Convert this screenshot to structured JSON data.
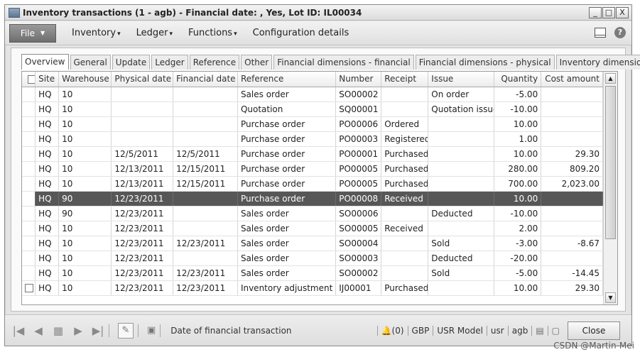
{
  "window": {
    "title": "Inventory transactions (1 - agb) - Financial date: , Yes, Lot ID: IL00034",
    "min_glyph": "_",
    "max_glyph": "□",
    "close_glyph": "X"
  },
  "menubar": {
    "file_label": "File",
    "items": [
      {
        "label": "Inventory",
        "caret": "▾"
      },
      {
        "label": "Ledger",
        "caret": "▾"
      },
      {
        "label": "Functions",
        "caret": "▾"
      },
      {
        "label": "Configuration details",
        "caret": ""
      }
    ],
    "help_glyph": "?"
  },
  "tabs": [
    "Overview",
    "General",
    "Update",
    "Ledger",
    "Reference",
    "Other",
    "Financial dimensions - financial",
    "Financial dimensions - physical",
    "Inventory dimensions"
  ],
  "grid": {
    "columns": [
      "",
      "Site",
      "Warehouse",
      "Physical date",
      "Financial date",
      "Reference",
      "Number",
      "Receipt",
      "Issue",
      "Quantity",
      "Cost amount"
    ],
    "selected_row_index": 7,
    "rows": [
      {
        "site": "HQ",
        "warehouse": "10",
        "physical_date": "",
        "financial_date": "",
        "reference": "Sales order",
        "number": "SO00002",
        "receipt": "",
        "issue": "On order",
        "quantity": "-5.00",
        "cost_amount": ""
      },
      {
        "site": "HQ",
        "warehouse": "10",
        "physical_date": "",
        "financial_date": "",
        "reference": "Quotation",
        "number": "SQ00001",
        "receipt": "",
        "issue": "Quotation issue",
        "quantity": "-10.00",
        "cost_amount": ""
      },
      {
        "site": "HQ",
        "warehouse": "10",
        "physical_date": "",
        "financial_date": "",
        "reference": "Purchase order",
        "number": "PO00006",
        "receipt": "Ordered",
        "issue": "",
        "quantity": "10.00",
        "cost_amount": ""
      },
      {
        "site": "HQ",
        "warehouse": "10",
        "physical_date": "",
        "financial_date": "",
        "reference": "Purchase order",
        "number": "PO00003",
        "receipt": "Registered",
        "issue": "",
        "quantity": "1.00",
        "cost_amount": ""
      },
      {
        "site": "HQ",
        "warehouse": "10",
        "physical_date": "12/5/2011",
        "financial_date": "12/5/2011",
        "reference": "Purchase order",
        "number": "PO00001",
        "receipt": "Purchased",
        "issue": "",
        "quantity": "10.00",
        "cost_amount": "29.30"
      },
      {
        "site": "HQ",
        "warehouse": "10",
        "physical_date": "12/13/2011",
        "financial_date": "12/15/2011",
        "reference": "Purchase order",
        "number": "PO00005",
        "receipt": "Purchased",
        "issue": "",
        "quantity": "280.00",
        "cost_amount": "809.20"
      },
      {
        "site": "HQ",
        "warehouse": "10",
        "physical_date": "12/13/2011",
        "financial_date": "12/15/2011",
        "reference": "Purchase order",
        "number": "PO00005",
        "receipt": "Purchased",
        "issue": "",
        "quantity": "700.00",
        "cost_amount": "2,023.00"
      },
      {
        "site": "HQ",
        "warehouse": "90",
        "physical_date": "12/23/2011",
        "financial_date": "",
        "reference": "Purchase order",
        "number": "PO00008",
        "receipt": "Received",
        "issue": "",
        "quantity": "10.00",
        "cost_amount": ""
      },
      {
        "site": "HQ",
        "warehouse": "90",
        "physical_date": "12/23/2011",
        "financial_date": "",
        "reference": "Sales order",
        "number": "SO00006",
        "receipt": "",
        "issue": "Deducted",
        "quantity": "-10.00",
        "cost_amount": ""
      },
      {
        "site": "HQ",
        "warehouse": "10",
        "physical_date": "12/23/2011",
        "financial_date": "",
        "reference": "Sales order",
        "number": "SO00005",
        "receipt": "Received",
        "issue": "",
        "quantity": "2.00",
        "cost_amount": ""
      },
      {
        "site": "HQ",
        "warehouse": "10",
        "physical_date": "12/23/2011",
        "financial_date": "12/23/2011",
        "reference": "Sales order",
        "number": "SO00004",
        "receipt": "",
        "issue": "Sold",
        "quantity": "-3.00",
        "cost_amount": "-8.67"
      },
      {
        "site": "HQ",
        "warehouse": "10",
        "physical_date": "12/23/2011",
        "financial_date": "",
        "reference": "Sales order",
        "number": "SO00003",
        "receipt": "",
        "issue": "Deducted",
        "quantity": "-20.00",
        "cost_amount": ""
      },
      {
        "site": "HQ",
        "warehouse": "10",
        "physical_date": "12/23/2011",
        "financial_date": "12/23/2011",
        "reference": "Sales order",
        "number": "SO00002",
        "receipt": "",
        "issue": "Sold",
        "quantity": "-5.00",
        "cost_amount": "-14.45"
      },
      {
        "site": "HQ",
        "warehouse": "10",
        "physical_date": "12/23/2011",
        "financial_date": "12/23/2011",
        "reference": "Inventory adjustment",
        "number": "IJ00001",
        "receipt": "Purchased",
        "issue": "",
        "quantity": "10.00",
        "cost_amount": "29.30"
      }
    ]
  },
  "statusbar": {
    "nav_first": "|◀",
    "nav_prev": "◀",
    "nav_grid": "▦",
    "nav_next": "▶",
    "nav_last": "▶|",
    "edit_glyph": "✎",
    "doc_glyph": "▣",
    "field_help": "Date of financial transaction",
    "notifications": "(0)",
    "currency": "GBP",
    "partition": "USR Model",
    "user": "usr",
    "company": "agb",
    "close_label": "Close"
  },
  "watermark": "CSDN @Martin-Mei"
}
